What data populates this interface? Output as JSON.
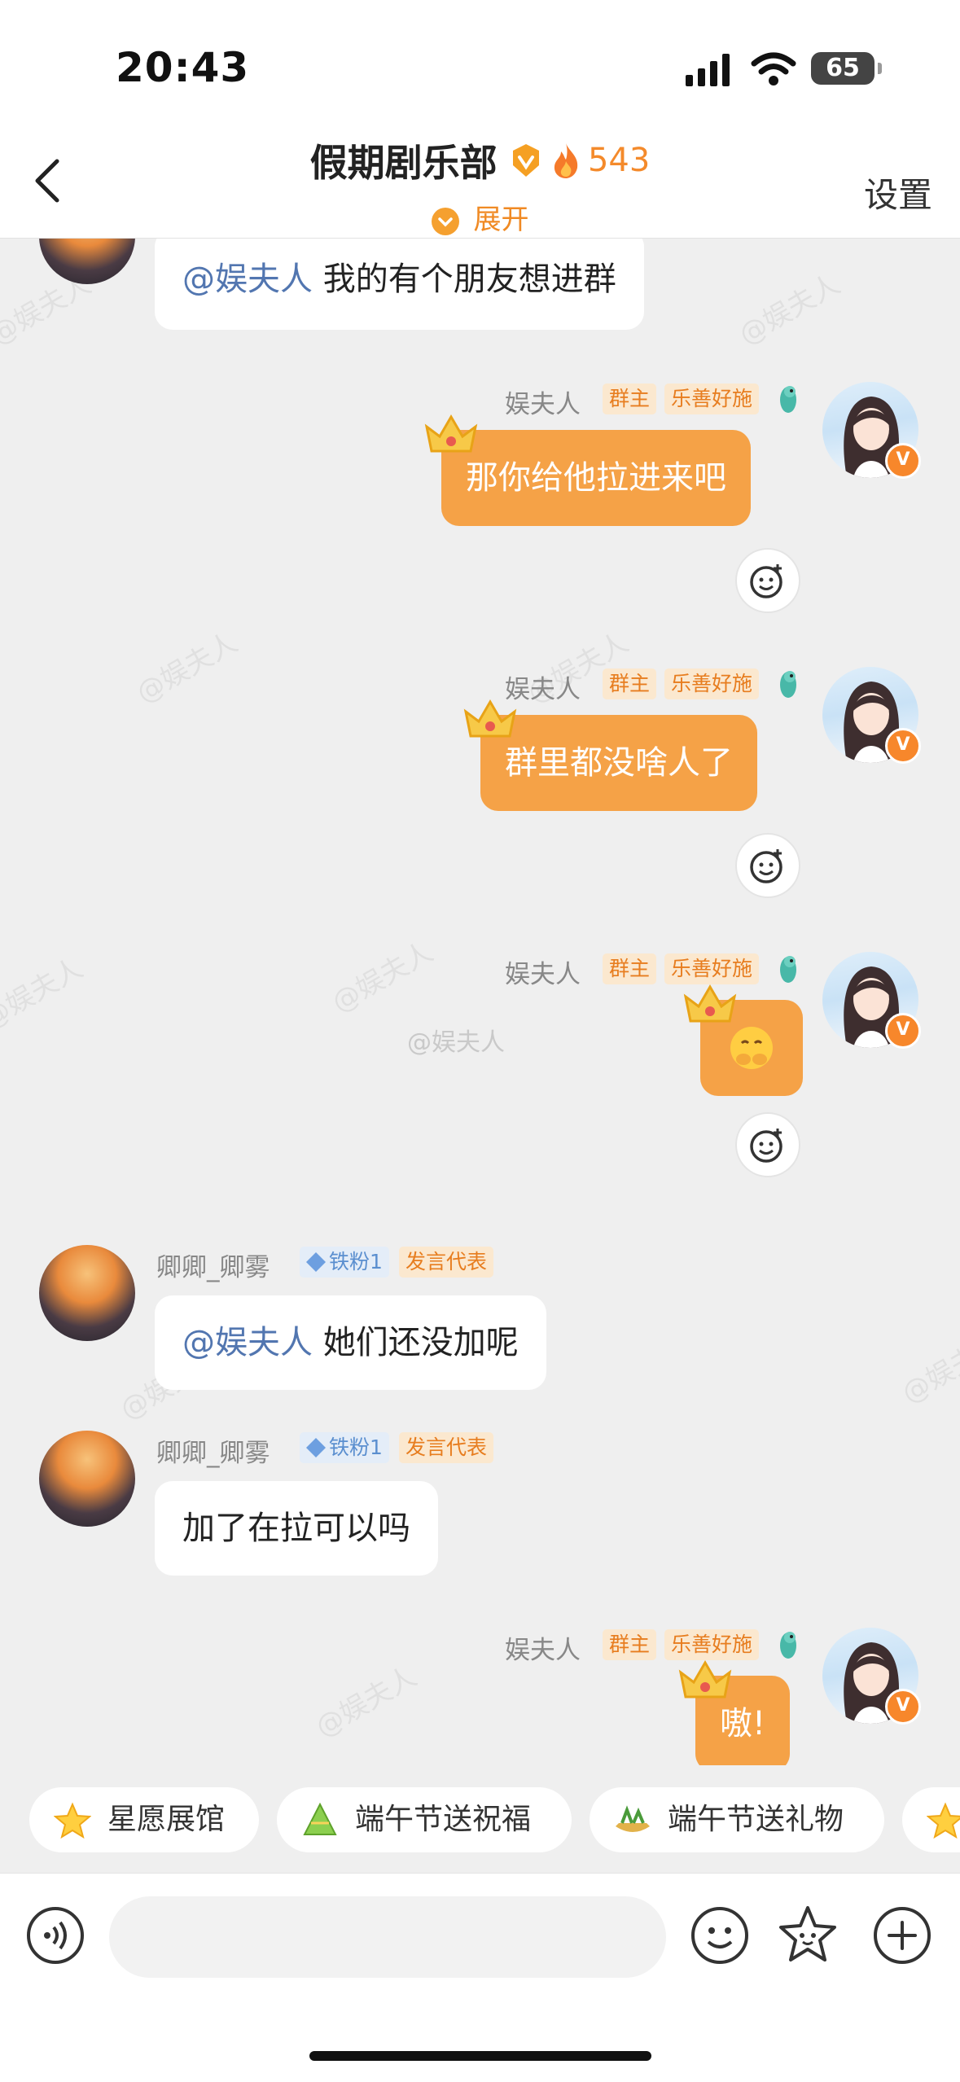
{
  "status": {
    "time": "20:43",
    "battery": "65"
  },
  "header": {
    "title": "假期剧乐部",
    "heat_count": "543",
    "expand_label": "展开",
    "settings_label": "设置"
  },
  "watermark_text": "@娱夫人",
  "center_watermark": "@娱夫人",
  "messages": [
    {
      "side": "left",
      "text_mention": "@娱夫人",
      "text": " 我的有个朋友想进群"
    },
    {
      "side": "right",
      "name": "娱夫人",
      "tag1": "群主",
      "tag2": "乐善好施",
      "text": "那你给他拉进来吧"
    },
    {
      "side": "right",
      "name": "娱夫人",
      "tag1": "群主",
      "tag2": "乐善好施",
      "text": "群里都没啥人了"
    },
    {
      "side": "right",
      "name": "娱夫人",
      "tag1": "群主",
      "tag2": "乐善好施",
      "text": "🤗"
    },
    {
      "side": "left",
      "name": "卿卿_卿雾",
      "tag1": "铁粉1",
      "tag2": "发言代表",
      "text_mention": "@娱夫人",
      "text": " 她们还没加呢"
    },
    {
      "side": "left",
      "name": "卿卿_卿雾",
      "tag1": "铁粉1",
      "tag2": "发言代表",
      "text": "加了在拉可以吗"
    },
    {
      "side": "right",
      "name": "娱夫人",
      "tag1": "群主",
      "tag2": "乐善好施",
      "text": "嗷!"
    }
  ],
  "quick_chips": [
    "星愿展馆",
    "端午节送祝福",
    "端午节送礼物"
  ],
  "icons": {
    "back": "chevron-left-icon",
    "verified": "v-badge-icon",
    "fire": "fire-icon",
    "react": "add-reaction-icon",
    "voice": "voice-icon",
    "emoji": "emoji-icon",
    "sticker": "sticker-icon",
    "plus": "plus-icon"
  },
  "colors": {
    "accent": "#f5a247",
    "mention": "#5276b0",
    "tag_orange": "#e77d1f",
    "tag_blue": "#5b8fcf"
  }
}
